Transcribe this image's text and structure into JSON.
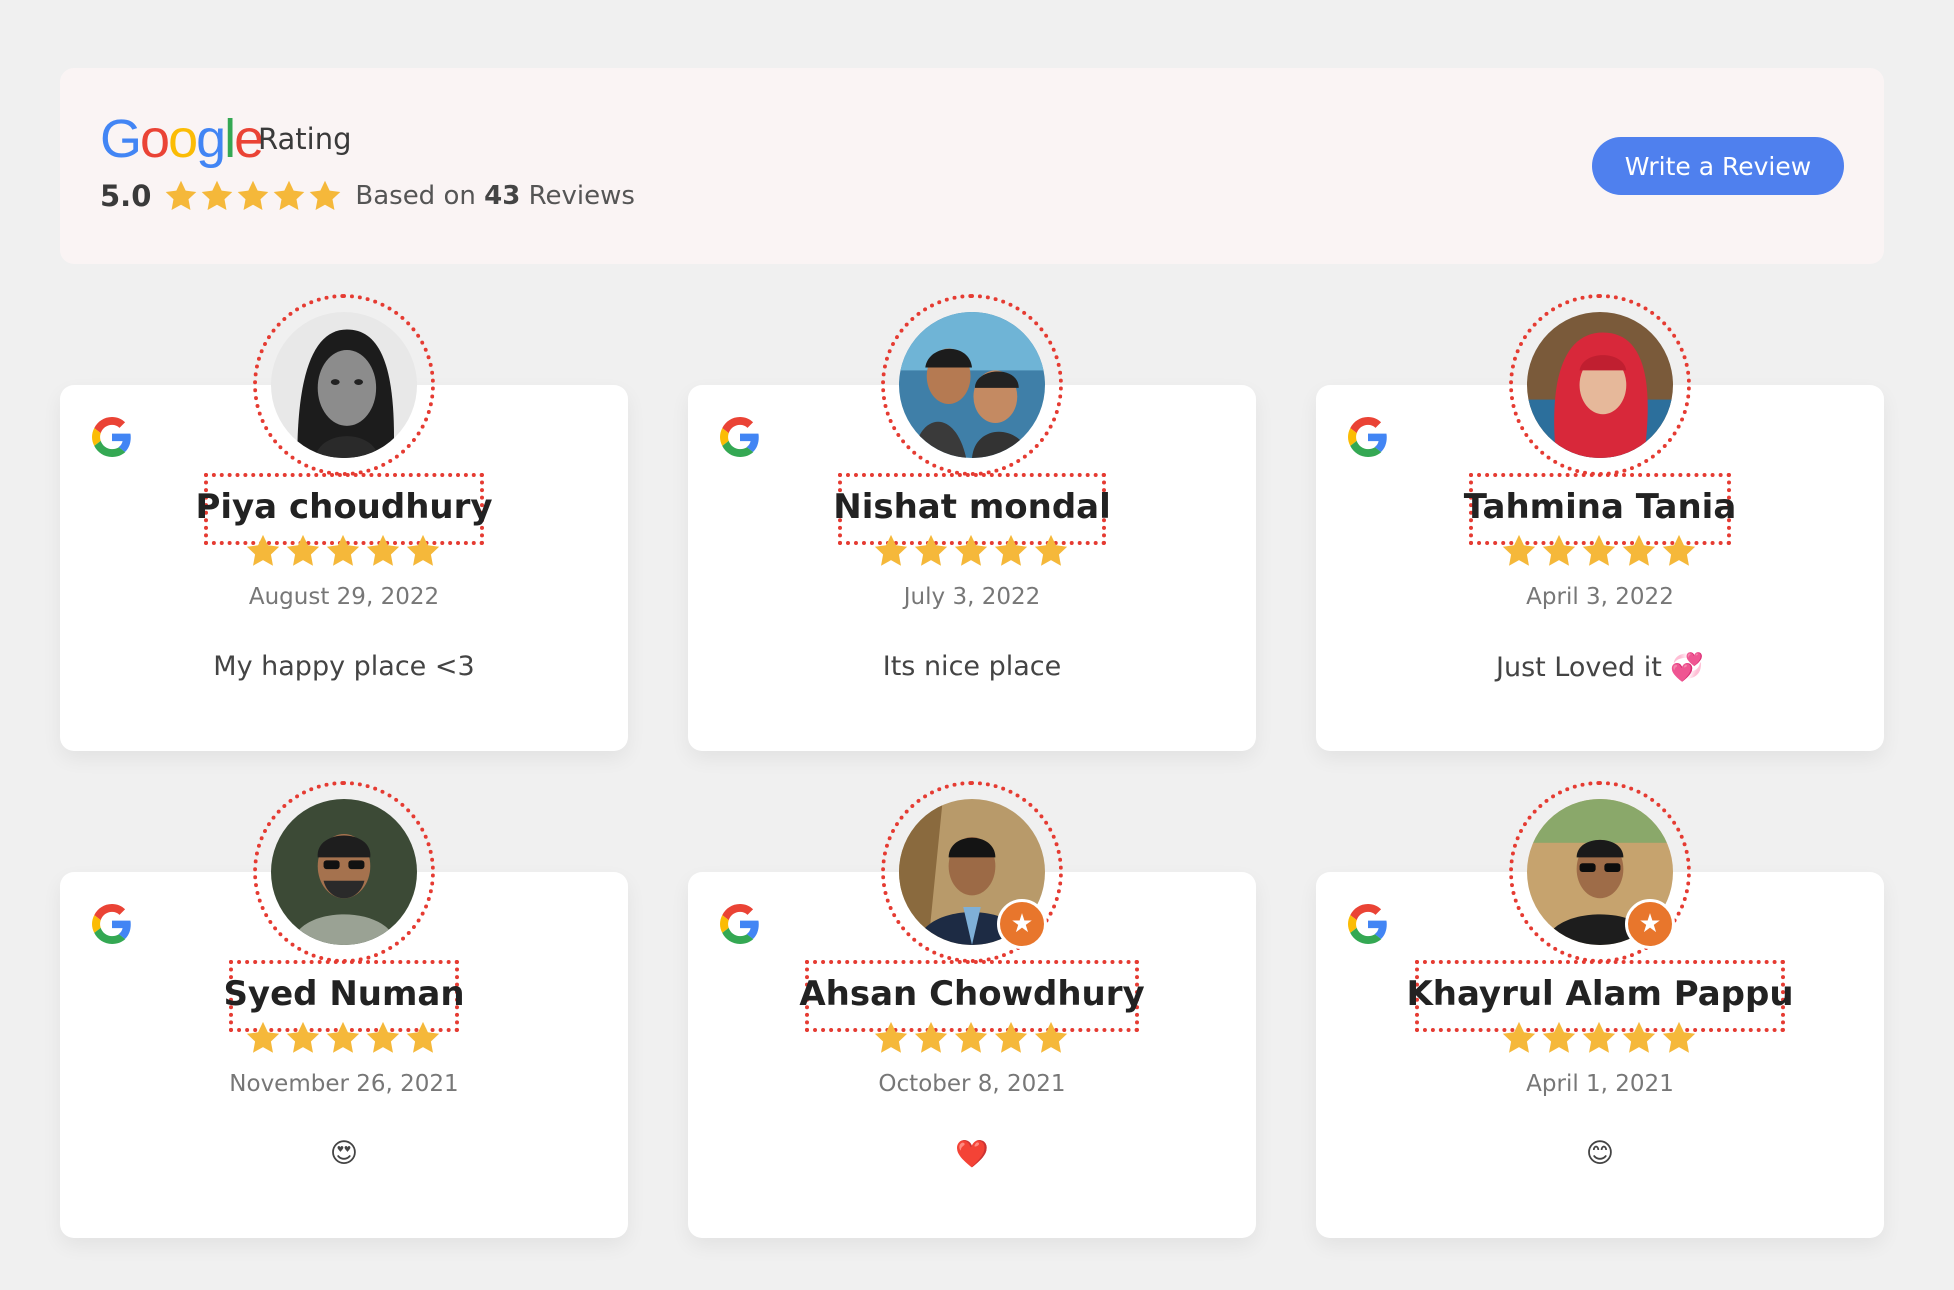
{
  "header": {
    "logo": [
      "G",
      "o",
      "o",
      "g",
      "l",
      "e"
    ],
    "logo_colors": [
      "#4285F4",
      "#EA4335",
      "#FBBC05",
      "#4285F4",
      "#34A853",
      "#EA4335"
    ],
    "rating_label": "Rating",
    "score": "5.0",
    "stars": 5,
    "based_on_prefix": "Based on",
    "review_count": "43",
    "reviews_suffix": "Reviews",
    "write_button": "Write a Review"
  },
  "colors": {
    "star": "#f5b83a",
    "accent_button": "#4f80ee",
    "dotted_outline": "#e53b32",
    "badge": "#e8762c"
  },
  "reviews": [
    {
      "name": "Piya choudhury",
      "date": "August 29, 2022",
      "text": "My happy place <3",
      "stars": 5,
      "source_icon": "google-g-icon",
      "avatar": "woman-bw-portrait",
      "badge": false
    },
    {
      "name": "Nishat mondal",
      "date": "July 3, 2022",
      "text": "Its nice place",
      "stars": 5,
      "source_icon": "google-g-icon",
      "avatar": "two-men-selfie",
      "badge": false
    },
    {
      "name": "Tahmina Tania",
      "date": "April 3, 2022",
      "text": "Just Loved it 💞",
      "stars": 5,
      "source_icon": "google-g-icon",
      "avatar": "woman-red-hijab",
      "badge": false
    },
    {
      "name": "Syed Numan",
      "date": "November 26, 2021",
      "text": "😍",
      "stars": 5,
      "source_icon": "google-g-icon",
      "avatar": "man-sunglasses-beard",
      "badge": false
    },
    {
      "name": "Ahsan Chowdhury",
      "date": "October 8, 2021",
      "text": "❤️",
      "stars": 5,
      "source_icon": "google-g-icon",
      "avatar": "man-suit",
      "badge": true
    },
    {
      "name": "Khayrul Alam Pappu",
      "date": "April 1, 2021",
      "text": "😊",
      "stars": 5,
      "source_icon": "google-g-icon",
      "avatar": "man-sunglasses-outdoor",
      "badge": true
    }
  ]
}
